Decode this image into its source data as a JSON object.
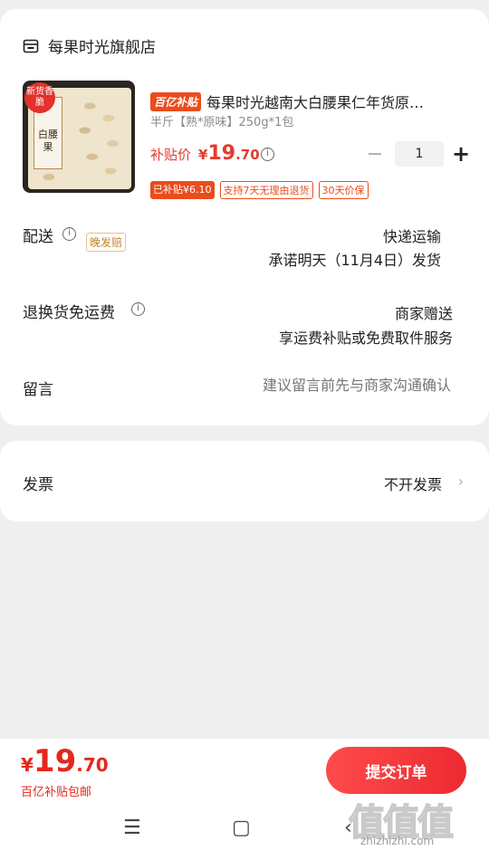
{
  "store": {
    "name": "每果时光旗舰店",
    "icon": "store-icon"
  },
  "product": {
    "tag": "百亿补贴",
    "title": "每果时光越南大白腰果仁年货原…",
    "spec": "半斤【熟*原味】250g*1包",
    "image_badge": "新货香脆",
    "image_label": "白腰果",
    "price_label": "补贴价",
    "price_currency": "¥",
    "price_int": "19",
    "price_dec": ".70",
    "quantity": "1",
    "promos": [
      "已补贴¥6.10",
      "支持7天无理由退货",
      "30天价保"
    ]
  },
  "delivery": {
    "label": "配送",
    "tag": "晚发赔",
    "method": "快递运输",
    "promise": "承诺明天（11月4日）发货"
  },
  "returns": {
    "label": "退换货免运费",
    "line1": "商家赠送",
    "line2": "享运费补贴或免费取件服务"
  },
  "message": {
    "label": "留言",
    "placeholder": "建议留言前先与商家沟通确认"
  },
  "invoice": {
    "label": "发票",
    "value": "不开发票",
    "chevron": "›"
  },
  "footer": {
    "currency": "¥",
    "total_int": "19",
    "total_dec": ".70",
    "subtitle": "百亿补贴包邮",
    "submit_label": "提交订单"
  },
  "nav": {
    "menu": "☰",
    "home": "▢",
    "back": "‹"
  },
  "watermark": {
    "text": "值值值",
    "sub": "zhizhizhi.com"
  },
  "colors": {
    "accent": "#e5281c",
    "bybt_orange": "#ea4c1c",
    "background": "#efefef"
  }
}
